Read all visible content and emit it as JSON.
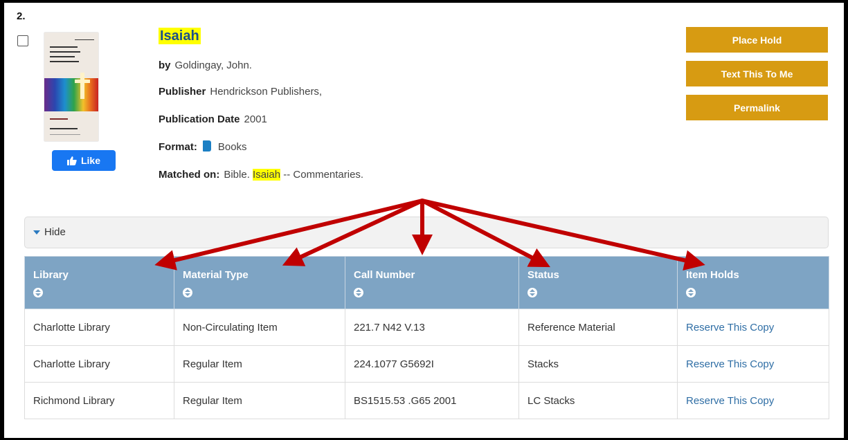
{
  "result": {
    "number": "2.",
    "title": "Isaiah",
    "author_label": "by",
    "author": "Goldingay, John.",
    "publisher_label": "Publisher",
    "publisher": "Hendrickson Publishers,",
    "pubdate_label": "Publication Date",
    "pubdate": "2001",
    "format_label": "Format:",
    "format": "Books",
    "matched_label": "Matched on:",
    "matched_pre": "Bible.",
    "matched_hl": "Isaiah",
    "matched_post": "-- Commentaries.",
    "like_label": "Like",
    "cover": {
      "series": "NEW INTERNATIONAL BIBLICAL COMMENTARY",
      "book": "ISAIAH",
      "author": "JOHN GOLDINGAY"
    }
  },
  "actions": {
    "place_hold": "Place Hold",
    "text_me": "Text This To Me",
    "permalink": "Permalink"
  },
  "holdings": {
    "toggle_label": "Hide",
    "columns": [
      "Library",
      "Material Type",
      "Call Number",
      "Status",
      "Item Holds"
    ],
    "rows": [
      [
        "Charlotte Library",
        "Non-Circulating Item",
        "221.7 N42 V.13",
        "Reference Material",
        "Reserve This Copy"
      ],
      [
        "Charlotte Library",
        "Regular Item",
        "224.1077 G5692I",
        "Stacks",
        "Reserve This Copy"
      ],
      [
        "Richmond Library",
        "Regular Item",
        "BS1515.53 .G65 2001",
        "LC Stacks",
        "Reserve This Copy"
      ]
    ]
  },
  "colors": {
    "highlight": "#ffff00",
    "button": "#d79b12",
    "table_header": "#7ea4c4",
    "link": "#2f6ea5",
    "arrow": "#c00000",
    "like": "#1877f2"
  },
  "icons": [
    "checkbox-icon",
    "thumbs-up-icon",
    "book-icon",
    "caret-down-icon",
    "sort-icon",
    "annotation-arrow"
  ]
}
